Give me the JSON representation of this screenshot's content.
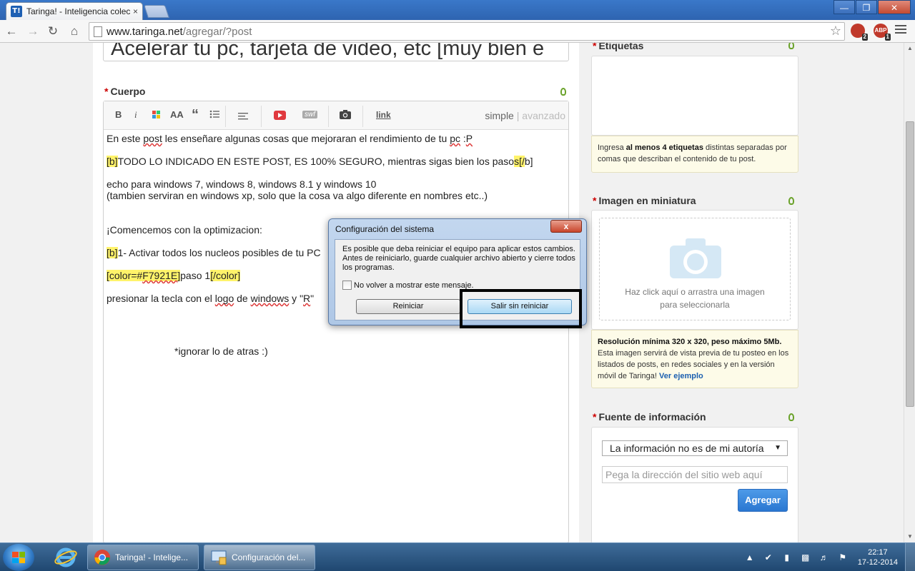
{
  "browser": {
    "tab_title": "Taringa! - Inteligencia colectiva",
    "tab_close": "×",
    "favicon_text": "T!",
    "url_host": "www.taringa.net",
    "url_path": "/agregar/?post",
    "extensions": [
      {
        "name": "adblock-icon",
        "label": "",
        "badge": "2",
        "color": "#c0392b"
      },
      {
        "name": "abp-icon",
        "label": "ABP",
        "badge": "1",
        "color": "#c0392b"
      }
    ]
  },
  "post": {
    "title_value": "Acelerar tu pc, tarjeta de video, etc [muy bien e",
    "body_label": "Cuerpo",
    "required_marker": "*",
    "toolbar": {
      "bold": "B",
      "italic": "i",
      "size": "AA",
      "quote": "“",
      "swf": "swf",
      "link": "link",
      "mode_simple": "simple",
      "mode_separator": "|",
      "mode_advanced": "avanzado"
    },
    "body": {
      "line1_a": "En este ",
      "line1_post": "post",
      "line1_b": " les enseñare algunas cosas que mejoraran el rendimiento de tu ",
      "line1_pc": "pc",
      "line1_c": " :",
      "line1_p": "P",
      "line2_open": "[b]",
      "line2_text": "TODO LO INDICADO EN ESTE POST, ES 100% SEGURO, mientras sigas bien los ",
      "line2_pasos": "paso",
      "line2_close": "s[/",
      "line2_close_b": "b]",
      "line3": "echo para windows 7, windows 8, windows 8.1 y windows 10",
      "line4": "(tambien serviran en windows xp, solo que la cosa va algo diferente en nombres etc..)",
      "line5": "¡Comencemos con la optimizacion:",
      "line6_open": "[b]",
      "line6_text": "1- Activar todos los nucleos posibles de tu PC",
      "line7_open": "[color=#",
      "line7_hex": "F7921E",
      "line7_br": "]",
      "line7_text": "paso 1",
      "line7_close": "[/color]",
      "line8_a": "presionar la tecla con el ",
      "line8_logo": "logo",
      "line8_b": " de ",
      "line8_windows": "windows",
      "line8_c": " y \"",
      "line8_r": "R",
      "line8_d": "\"",
      "line9": "*ignorar lo de atras :)"
    }
  },
  "sidebar": {
    "tags": {
      "label": "Etiquetas",
      "hint_a": "Ingresa ",
      "hint_b": "al menos 4 etiquetas",
      "hint_c": " distintas separadas por comas que describan el contenido de tu post."
    },
    "thumbnail": {
      "label": "Imagen en miniatura",
      "drop_line1": "Haz click aquí o arrastra una imagen",
      "drop_line2": "para seleccionarla",
      "hint_bold": "Resolución mínima 320 x 320, peso máximo 5Mb.",
      "hint_text": "Esta imagen servirá de vista previa de tu posteo en los listados de posts, en redes sociales y en la versión móvil de Taringa! ",
      "hint_link": "Ver ejemplo"
    },
    "source": {
      "label": "Fuente de información",
      "select_value": "La información no es de mi autoría",
      "input_placeholder": "Pega la dirección del sitio web aquí",
      "add_button": "Agregar"
    }
  },
  "dialog": {
    "title": "Configuración del sistema",
    "close": "x",
    "message": "Es posible que deba reiniciar el equipo para aplicar estos cambios. Antes de reiniciarlo, guarde cualquier archivo abierto y cierre todos los programas.",
    "checkbox_label": "No volver a mostrar este mensaje.",
    "restart_button": "Reiniciar",
    "exit_button": "Salir sin reiniciar"
  },
  "taskbar": {
    "tasks": [
      {
        "label": "Taringa! - Intelige...",
        "icon": "chrome-icon"
      },
      {
        "label": "Configuración del...",
        "icon": "msconfig-icon"
      }
    ],
    "time": "22:17",
    "date": "17-12-2014"
  }
}
